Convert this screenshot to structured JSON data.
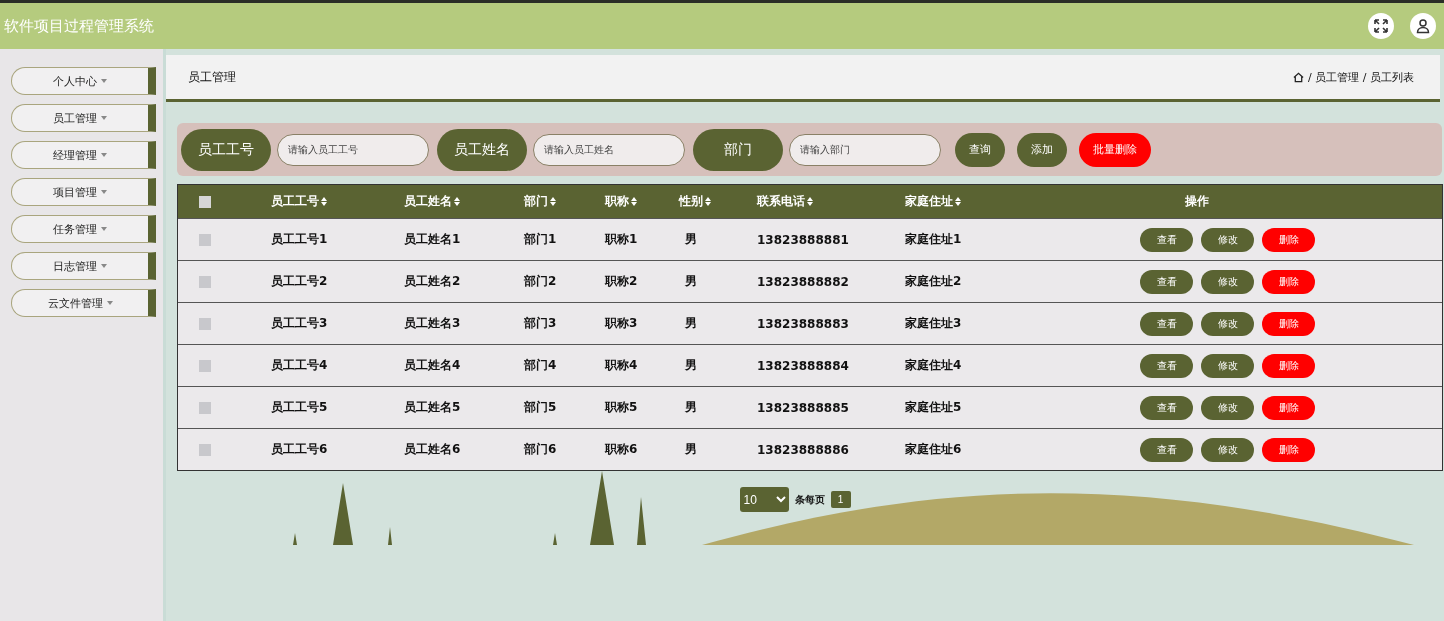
{
  "header": {
    "title": "软件项目过程管理系统"
  },
  "sidebar": {
    "items": [
      {
        "label": "个人中心",
        "selected": false
      },
      {
        "label": "员工管理",
        "selected": false
      },
      {
        "label": "经理管理",
        "selected": false
      },
      {
        "label": "项目管理",
        "selected": false
      },
      {
        "label": "任务管理",
        "selected": false
      },
      {
        "label": "日志管理",
        "selected": false
      },
      {
        "label": "云文件管理",
        "selected": false
      }
    ]
  },
  "page_title": "员工管理",
  "breadcrumb": "/ 员工管理 / 员工列表",
  "search": {
    "fields": [
      {
        "label": "员工工号",
        "placeholder": "请输入员工工号"
      },
      {
        "label": "员工姓名",
        "placeholder": "请输入员工姓名"
      },
      {
        "label": "部门",
        "placeholder": "请输入部门"
      }
    ],
    "buttons": [
      {
        "label": "查询",
        "kind": "normal"
      },
      {
        "label": "添加",
        "kind": "normal"
      },
      {
        "label": "批量删除",
        "kind": "danger"
      }
    ]
  },
  "table": {
    "select_all_checked": false,
    "columns": [
      "员工工号",
      "员工姓名",
      "部门",
      "职称",
      "性别",
      "联系电话",
      "家庭住址",
      "操作"
    ],
    "rows": [
      {
        "checked": false,
        "cells": [
          "员工工号1",
          "员工姓名1",
          "部门1",
          "职称1",
          "男",
          "13823888881",
          "家庭住址1"
        ],
        "actions": [
          {
            "label": "查看",
            "kind": "normal"
          },
          {
            "label": "修改",
            "kind": "normal"
          },
          {
            "label": "删除",
            "kind": "danger"
          }
        ]
      },
      {
        "checked": false,
        "cells": [
          "员工工号2",
          "员工姓名2",
          "部门2",
          "职称2",
          "男",
          "13823888882",
          "家庭住址2"
        ],
        "actions": [
          {
            "label": "查看",
            "kind": "normal"
          },
          {
            "label": "修改",
            "kind": "normal"
          },
          {
            "label": "删除",
            "kind": "danger"
          }
        ]
      },
      {
        "checked": false,
        "cells": [
          "员工工号3",
          "员工姓名3",
          "部门3",
          "职称3",
          "男",
          "13823888883",
          "家庭住址3"
        ],
        "actions": [
          {
            "label": "查看",
            "kind": "normal"
          },
          {
            "label": "修改",
            "kind": "normal"
          },
          {
            "label": "删除",
            "kind": "danger"
          }
        ]
      },
      {
        "checked": false,
        "cells": [
          "员工工号4",
          "员工姓名4",
          "部门4",
          "职称4",
          "男",
          "13823888884",
          "家庭住址4"
        ],
        "actions": [
          {
            "label": "查看",
            "kind": "normal"
          },
          {
            "label": "修改",
            "kind": "normal"
          },
          {
            "label": "删除",
            "kind": "danger"
          }
        ]
      },
      {
        "checked": false,
        "cells": [
          "员工工号5",
          "员工姓名5",
          "部门5",
          "职称5",
          "男",
          "13823888885",
          "家庭住址5"
        ],
        "actions": [
          {
            "label": "查看",
            "kind": "normal"
          },
          {
            "label": "修改",
            "kind": "normal"
          },
          {
            "label": "删除",
            "kind": "danger"
          }
        ]
      },
      {
        "checked": false,
        "cells": [
          "员工工号6",
          "员工姓名6",
          "部门6",
          "职称6",
          "男",
          "13823888886",
          "家庭住址6"
        ],
        "actions": [
          {
            "label": "查看",
            "kind": "normal"
          },
          {
            "label": "修改",
            "kind": "normal"
          },
          {
            "label": "删除",
            "kind": "danger"
          }
        ]
      }
    ]
  },
  "pagination": {
    "page_size": "10",
    "page_size_label": "条每页",
    "pages": [
      {
        "label": "1",
        "selected": true
      }
    ]
  }
}
